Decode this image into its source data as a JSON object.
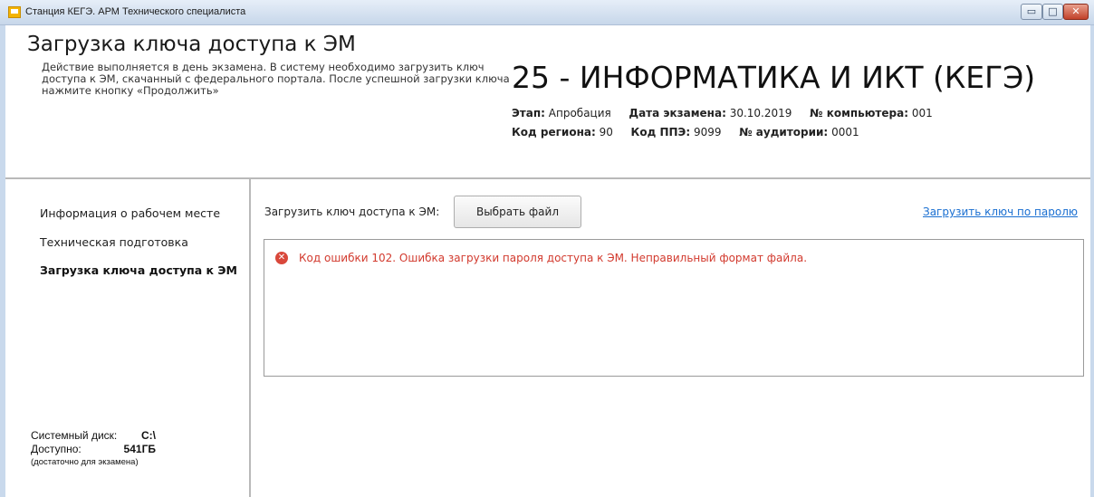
{
  "window": {
    "title": "Станция КЕГЭ. АРМ Технического специалиста",
    "controls": {
      "minimize": "▭",
      "maximize": "□",
      "close": "✕"
    }
  },
  "header": {
    "title": "Загрузка ключа доступа к ЭМ",
    "description": "Действие выполняется в день экзамена. В систему необходимо загрузить ключ доступа к ЭМ, скачанный с федерального портала. После успешной загрузки ключа нажмите кнопку «Продолжить»",
    "subject": "25 - ИНФОРМАТИКА И ИКТ (КЕГЭ)",
    "meta": {
      "stage_label": "Этап:",
      "stage_value": "Апробация",
      "date_label": "Дата экзамена:",
      "date_value": "30.10.2019",
      "computer_label": "№ компьютера:",
      "computer_value": "001",
      "region_label": "Код региона:",
      "region_value": "90",
      "ppe_label": "Код ППЭ:",
      "ppe_value": "9099",
      "room_label": "№ аудитории:",
      "room_value": "0001"
    }
  },
  "sidebar": {
    "items": [
      {
        "label": "Информация о рабочем месте"
      },
      {
        "label": "Техническая подготовка"
      },
      {
        "label": "Загрузка ключа доступа к ЭМ"
      }
    ],
    "active_index": 2,
    "disk": {
      "system_label": "Системный диск:",
      "system_value": "C:\\",
      "available_label": "Доступно:",
      "available_value": "541ГБ",
      "note": "(достаточно для экзамена)"
    }
  },
  "main": {
    "load_label": "Загрузить ключ доступа к ЭМ:",
    "choose_file": "Выбрать файл",
    "password_link": "Загрузить ключ по паролю",
    "error_icon": "error-icon",
    "error_message": "Код ошибки 102. Ошибка загрузки пароля доступа к ЭМ. Неправильный формат файла."
  },
  "colors": {
    "error": "#d23a2e",
    "link": "#1a6fd1",
    "divider": "#b9b9b9",
    "titlebar": "#c7d7ea"
  }
}
